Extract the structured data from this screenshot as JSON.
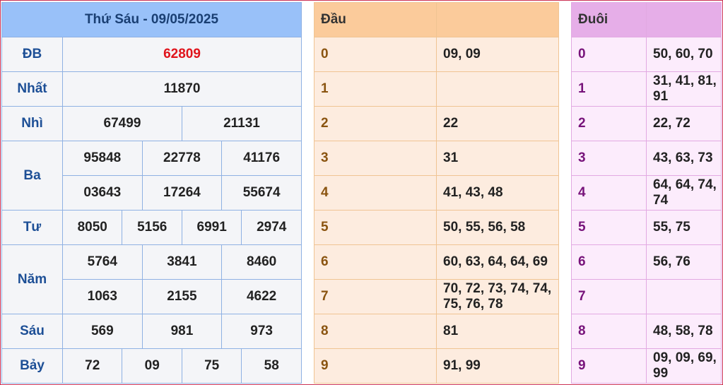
{
  "results": {
    "title": "Thứ Sáu - 09/05/2025",
    "db_label": "ĐB",
    "db": "62809",
    "nhat_label": "Nhất",
    "nhat": "11870",
    "nhi_label": "Nhì",
    "nhi": [
      "67499",
      "21131"
    ],
    "ba_label": "Ba",
    "ba": [
      "95848",
      "22778",
      "41176",
      "03643",
      "17264",
      "55674"
    ],
    "tu_label": "Tư",
    "tu": [
      "8050",
      "5156",
      "6991",
      "2974"
    ],
    "nam_label": "Năm",
    "nam": [
      "5764",
      "3841",
      "8460",
      "1063",
      "2155",
      "4622"
    ],
    "sau_label": "Sáu",
    "sau": [
      "569",
      "981",
      "973"
    ],
    "bay_label": "Bảy",
    "bay": [
      "72",
      "09",
      "75",
      "58"
    ]
  },
  "dau": {
    "header": "Đầu",
    "rows": [
      {
        "k": "0",
        "v": "09, 09"
      },
      {
        "k": "1",
        "v": ""
      },
      {
        "k": "2",
        "v": "22"
      },
      {
        "k": "3",
        "v": "31"
      },
      {
        "k": "4",
        "v": "41, 43, 48"
      },
      {
        "k": "5",
        "v": "50, 55, 56, 58"
      },
      {
        "k": "6",
        "v": "60, 63, 64, 64, 69"
      },
      {
        "k": "7",
        "v": "70, 72, 73, 74, 74, 75, 76, 78"
      },
      {
        "k": "8",
        "v": "81"
      },
      {
        "k": "9",
        "v": "91, 99"
      }
    ]
  },
  "duoi": {
    "header": "Đuôi",
    "rows": [
      {
        "k": "0",
        "v": "50, 60, 70"
      },
      {
        "k": "1",
        "v": "31, 41, 81, 91"
      },
      {
        "k": "2",
        "v": "22, 72"
      },
      {
        "k": "3",
        "v": "43, 63, 73"
      },
      {
        "k": "4",
        "v": "64, 64, 74, 74"
      },
      {
        "k": "5",
        "v": "55, 75"
      },
      {
        "k": "6",
        "v": "56, 76"
      },
      {
        "k": "7",
        "v": ""
      },
      {
        "k": "8",
        "v": "48, 58, 78"
      },
      {
        "k": "9",
        "v": "09, 09, 69, 99"
      }
    ]
  }
}
